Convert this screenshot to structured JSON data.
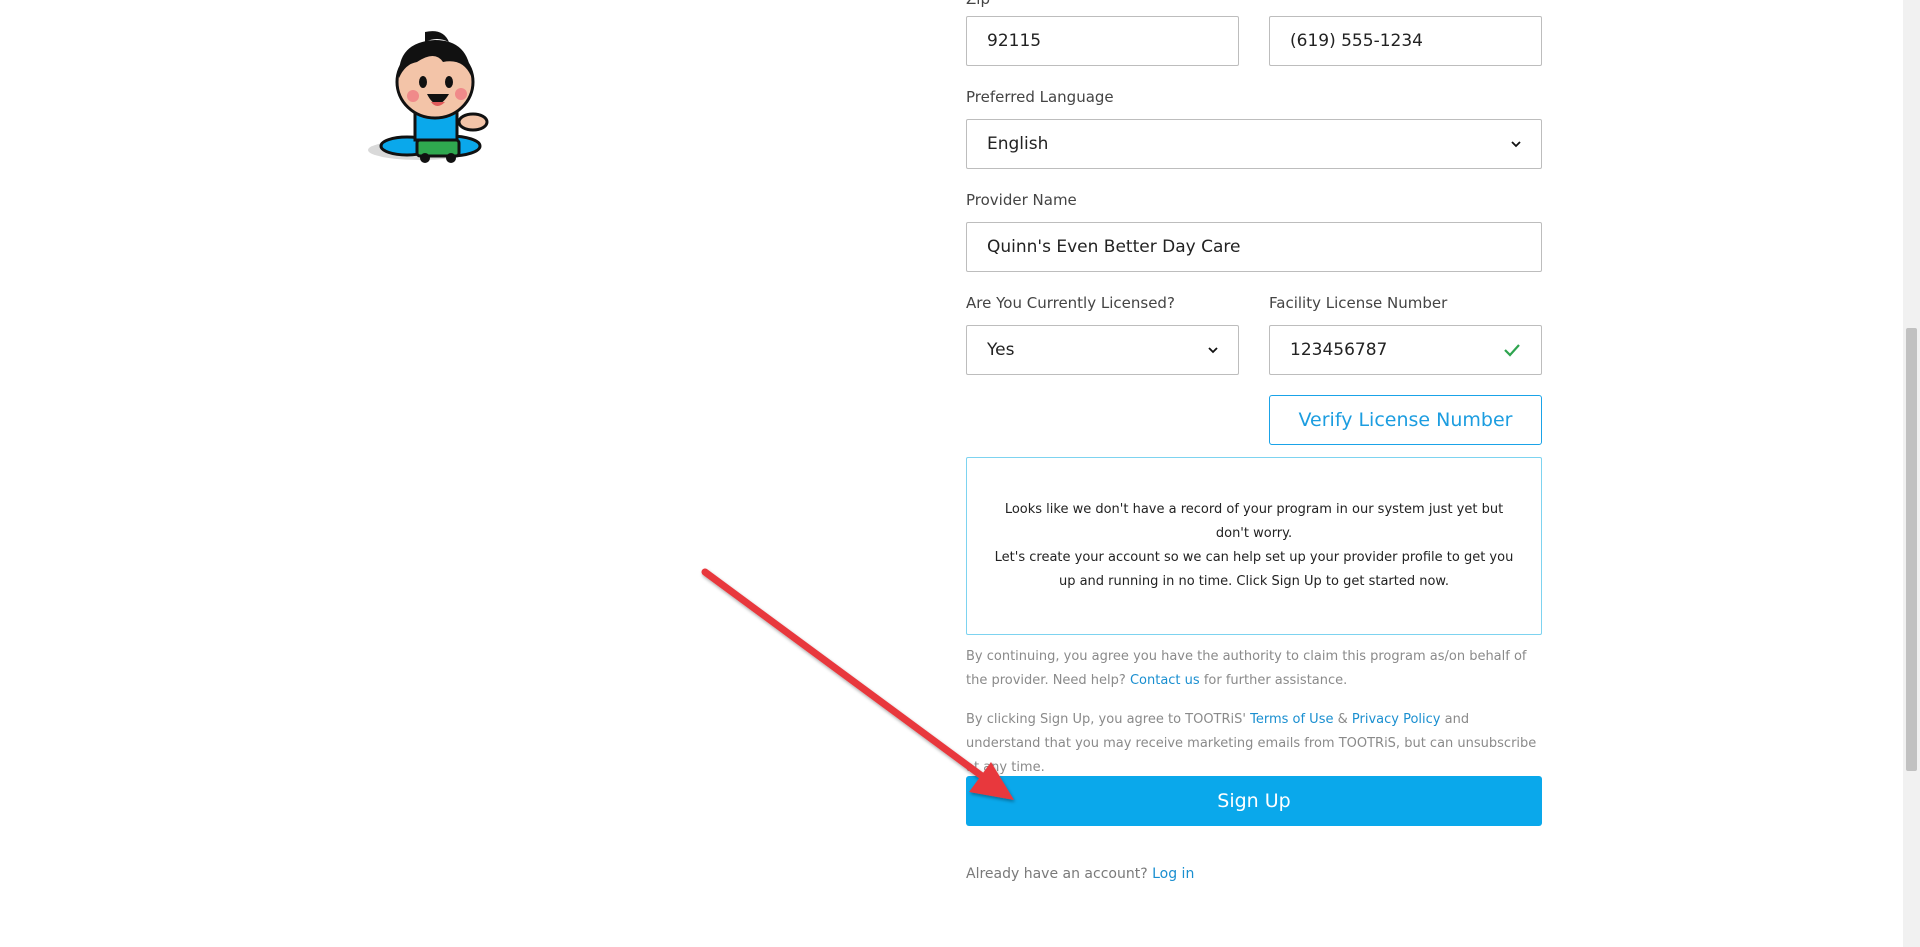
{
  "form": {
    "zip_value": "92115",
    "phone_value": "(619) 555-1234",
    "preferred_language_label": "Preferred Language",
    "preferred_language_value": "English",
    "provider_name_label": "Provider Name",
    "provider_name_value": "Quinn's Even Better Day Care",
    "licensed_label": "Are You Currently Licensed?",
    "licensed_value": "Yes",
    "license_number_label": "Facility License Number",
    "license_number_value": "123456787",
    "verify_button_label": "Verify License Number"
  },
  "notice": {
    "line1": "Looks like we don't have a record of your program in our system just yet but don't worry.",
    "line2": "Let's create your account so we can help set up your provider profile to get you up and running in no time. Click Sign Up to get started now."
  },
  "authority": {
    "text_before": "By continuing, you agree you have the authority to claim this program as/on behalf of the provider. Need help? ",
    "contact_link": "Contact us",
    "text_after": " for further assistance."
  },
  "terms": {
    "text_before": "By clicking Sign Up, you agree to TOOTRiS' ",
    "terms_link": "Terms of Use",
    "amp": " & ",
    "privacy_link": "Privacy Policy",
    "text_after": " and understand that you may receive marketing emails from TOOTRiS, but can unsubscribe at any time."
  },
  "signup_button_label": "Sign Up",
  "login": {
    "prompt": "Already have an account? ",
    "link": "Log in"
  },
  "colors": {
    "accent": "#0aa8eb",
    "link": "#1a8fd0",
    "success": "#2ea44f",
    "annotation_arrow": "#e8383d"
  },
  "icons": [
    "mascot-illustration",
    "chevron-down-icon",
    "check-icon",
    "annotation-arrow"
  ]
}
